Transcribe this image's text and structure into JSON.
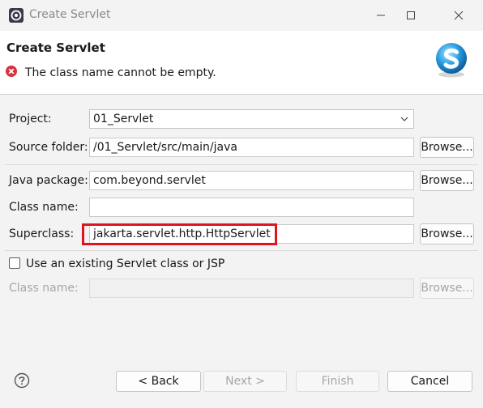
{
  "window": {
    "title": "Create Servlet"
  },
  "header": {
    "title": "Create Servlet",
    "message": "The class name cannot be empty."
  },
  "form": {
    "project": {
      "label": "Project:",
      "value": "01_Servlet"
    },
    "source_folder": {
      "label": "Source folder:",
      "value": "/01_Servlet/src/main/java",
      "button": "Browse..."
    },
    "java_package": {
      "label": "Java package:",
      "value": "com.beyond.servlet",
      "button": "Browse..."
    },
    "class_name": {
      "label": "Class name:",
      "value": ""
    },
    "superclass": {
      "label": "Superclass:",
      "value": "jakarta.servlet.http.HttpServlet",
      "button": "Browse..."
    },
    "existing": {
      "checkbox_label": "Use an existing Servlet class or JSP",
      "checked": false,
      "class_label": "Class name:",
      "value": "",
      "button": "Browse..."
    }
  },
  "footer": {
    "back": "< Back",
    "next": "Next >",
    "finish": "Finish",
    "cancel": "Cancel"
  },
  "colors": {
    "error": "#e0141e",
    "header_bg": "#ffffff",
    "dialog_bg": "#f3f3f3"
  },
  "icons": [
    "eclipse-app-icon",
    "minimize-icon",
    "maximize-icon",
    "close-icon",
    "error-icon",
    "servlet-logo",
    "chevron-down-icon",
    "help-icon"
  ]
}
